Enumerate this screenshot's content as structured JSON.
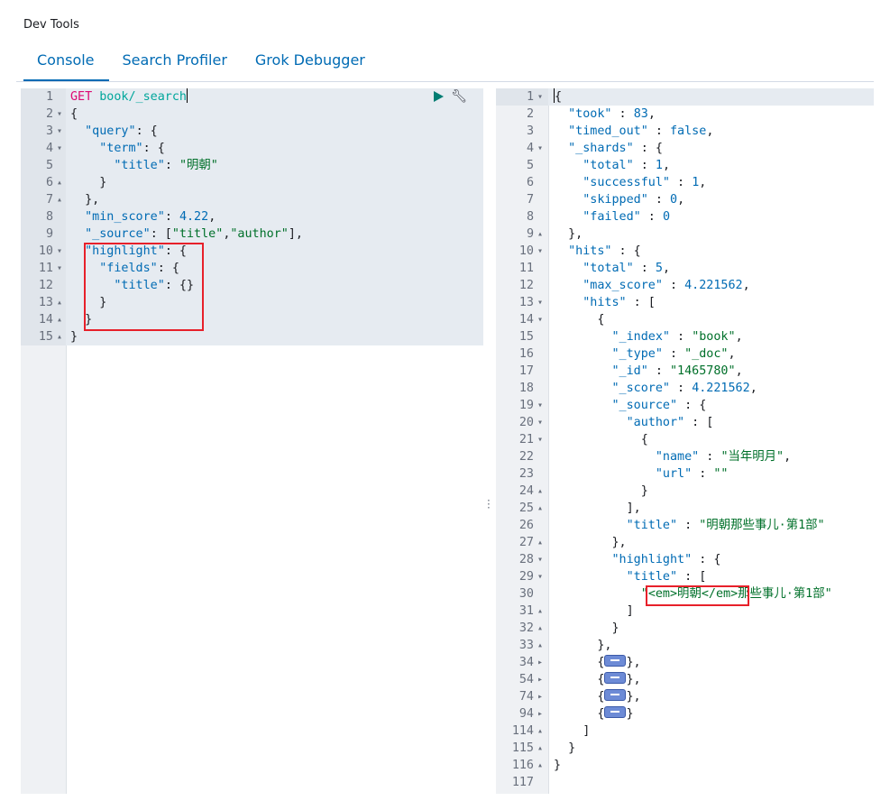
{
  "app": {
    "title": "Dev Tools"
  },
  "tabs": [
    {
      "label": "Console",
      "active": true
    },
    {
      "label": "Search Profiler",
      "active": false
    },
    {
      "label": "Grok Debugger",
      "active": false
    }
  ],
  "request": {
    "method": "GET",
    "url": "book/_search",
    "lines": [
      {
        "n": "1"
      },
      {
        "n": "2"
      },
      {
        "n": "3"
      },
      {
        "n": "4"
      },
      {
        "n": "5"
      },
      {
        "n": "6"
      },
      {
        "n": "7"
      },
      {
        "n": "8"
      },
      {
        "n": "9"
      },
      {
        "n": "10"
      },
      {
        "n": "11"
      },
      {
        "n": "12"
      },
      {
        "n": "13"
      },
      {
        "n": "14"
      },
      {
        "n": "15"
      }
    ],
    "query_key": "\"query\"",
    "term_key": "\"term\"",
    "title_key": "\"title\"",
    "title_value": "\"明朝\"",
    "min_score_key": "\"min_score\"",
    "min_score_value": "4.22",
    "source_key": "\"_source\"",
    "source_value_1": "\"title\"",
    "source_value_2": "\"author\"",
    "highlight_key": "\"highlight\"",
    "fields_key": "\"fields\"",
    "fields_title_key": "\"title\""
  },
  "response": {
    "took_key": "\"took\"",
    "took_value": "83",
    "timed_out_key": "\"timed_out\"",
    "timed_out_value": "false",
    "shards_key": "\"_shards\"",
    "total_key": "\"total\"",
    "shards_total": "1",
    "successful_key": "\"successful\"",
    "successful_value": "1",
    "skipped_key": "\"skipped\"",
    "skipped_value": "0",
    "failed_key": "\"failed\"",
    "failed_value": "0",
    "hits_key": "\"hits\"",
    "hits_total": "5",
    "max_score_key": "\"max_score\"",
    "max_score_value": "4.221562",
    "index_key": "\"_index\"",
    "index_value": "\"book\"",
    "type_key": "\"_type\"",
    "type_value": "\"_doc\"",
    "id_key": "\"_id\"",
    "id_value": "\"1465780\"",
    "score_key": "\"_score\"",
    "score_value": "4.221562",
    "source_key": "\"_source\"",
    "author_key": "\"author\"",
    "name_key": "\"name\"",
    "name_value": "\"当年明月\"",
    "url_key": "\"url\"",
    "url_value": "\"\"",
    "title_key": "\"title\"",
    "title_value": "\"明朝那些事儿·第1部\"",
    "highlight_key": "\"highlight\"",
    "highlight_em": "<em>明朝</em>",
    "highlight_rest": "那些事儿·第1部\"",
    "line_numbers": [
      "1",
      "2",
      "3",
      "4",
      "5",
      "6",
      "7",
      "8",
      "9",
      "10",
      "11",
      "12",
      "13",
      "14",
      "15",
      "16",
      "17",
      "18",
      "19",
      "20",
      "21",
      "22",
      "23",
      "24",
      "25",
      "26",
      "27",
      "28",
      "29",
      "30",
      "31",
      "32",
      "33",
      "34",
      "54",
      "74",
      "94",
      "114",
      "115",
      "116",
      "117"
    ]
  }
}
